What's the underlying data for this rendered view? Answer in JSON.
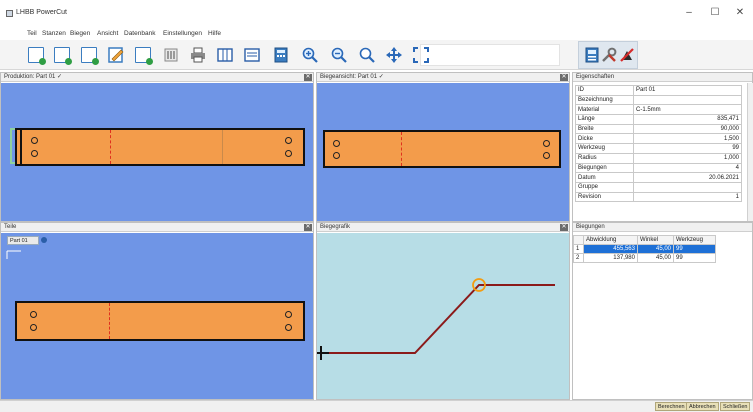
{
  "window": {
    "title": "LHBB PowerCut",
    "minimize": "–",
    "maximize": "☐",
    "close": "✕"
  },
  "menu": [
    "Teil",
    "Stanzen",
    "Biegen",
    "Ansicht",
    "Datenbank",
    "Einstellungen",
    "Hilfe"
  ],
  "panels": {
    "produktion": {
      "title": "Produktion: Part 01 ✓"
    },
    "biegeansicht": {
      "title": "Biegeansicht: Part 01 ✓"
    },
    "eigenschaften": {
      "title": "Eigenschaften"
    },
    "teile": {
      "title": "Teile",
      "tab": "Part 01"
    },
    "biegegrafik": {
      "title": "Biegegrafik"
    },
    "biegungen": {
      "title": "Biegungen"
    }
  },
  "properties": [
    [
      "ID",
      "Part 01"
    ],
    [
      "Bezeichnung",
      ""
    ],
    [
      "Material",
      "C-1.5mm"
    ],
    [
      "Länge",
      "835,471"
    ],
    [
      "Breite",
      "90,000"
    ],
    [
      "Dicke",
      "1,500"
    ],
    [
      "Werkzeug",
      "99"
    ],
    [
      "Radius",
      "1,000"
    ],
    [
      "Biegungen",
      "4"
    ],
    [
      "Datum",
      "20.06.2021"
    ],
    [
      "Gruppe",
      ""
    ],
    [
      "Revision",
      "1"
    ]
  ],
  "bends": {
    "headers": [
      "",
      "Abwicklung",
      "Winkel",
      "Werkzeug"
    ],
    "rows": [
      [
        "1",
        "455,563",
        "45,00",
        "99"
      ],
      [
        "2",
        "137,980",
        "45,00",
        "99"
      ]
    ]
  },
  "status_buttons": [
    "Berechnen",
    "Abbrechen",
    "Schließen"
  ],
  "colors": {
    "canvas_blue": "#6f95e6",
    "part_orange": "#f39c4b",
    "graph_bg": "#b7dde6",
    "bend_line": "#8b1a1a"
  }
}
